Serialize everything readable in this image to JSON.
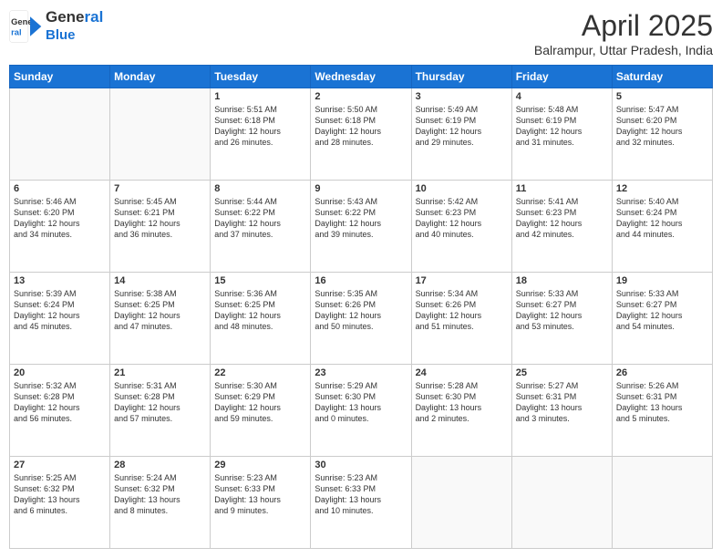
{
  "header": {
    "logo_line1": "General",
    "logo_line2": "Blue",
    "title": "April 2025",
    "subtitle": "Balrampur, Uttar Pradesh, India"
  },
  "weekdays": [
    "Sunday",
    "Monday",
    "Tuesday",
    "Wednesday",
    "Thursday",
    "Friday",
    "Saturday"
  ],
  "weeks": [
    [
      {
        "day": "",
        "info": ""
      },
      {
        "day": "",
        "info": ""
      },
      {
        "day": "1",
        "info": "Sunrise: 5:51 AM\nSunset: 6:18 PM\nDaylight: 12 hours\nand 26 minutes."
      },
      {
        "day": "2",
        "info": "Sunrise: 5:50 AM\nSunset: 6:18 PM\nDaylight: 12 hours\nand 28 minutes."
      },
      {
        "day": "3",
        "info": "Sunrise: 5:49 AM\nSunset: 6:19 PM\nDaylight: 12 hours\nand 29 minutes."
      },
      {
        "day": "4",
        "info": "Sunrise: 5:48 AM\nSunset: 6:19 PM\nDaylight: 12 hours\nand 31 minutes."
      },
      {
        "day": "5",
        "info": "Sunrise: 5:47 AM\nSunset: 6:20 PM\nDaylight: 12 hours\nand 32 minutes."
      }
    ],
    [
      {
        "day": "6",
        "info": "Sunrise: 5:46 AM\nSunset: 6:20 PM\nDaylight: 12 hours\nand 34 minutes."
      },
      {
        "day": "7",
        "info": "Sunrise: 5:45 AM\nSunset: 6:21 PM\nDaylight: 12 hours\nand 36 minutes."
      },
      {
        "day": "8",
        "info": "Sunrise: 5:44 AM\nSunset: 6:22 PM\nDaylight: 12 hours\nand 37 minutes."
      },
      {
        "day": "9",
        "info": "Sunrise: 5:43 AM\nSunset: 6:22 PM\nDaylight: 12 hours\nand 39 minutes."
      },
      {
        "day": "10",
        "info": "Sunrise: 5:42 AM\nSunset: 6:23 PM\nDaylight: 12 hours\nand 40 minutes."
      },
      {
        "day": "11",
        "info": "Sunrise: 5:41 AM\nSunset: 6:23 PM\nDaylight: 12 hours\nand 42 minutes."
      },
      {
        "day": "12",
        "info": "Sunrise: 5:40 AM\nSunset: 6:24 PM\nDaylight: 12 hours\nand 44 minutes."
      }
    ],
    [
      {
        "day": "13",
        "info": "Sunrise: 5:39 AM\nSunset: 6:24 PM\nDaylight: 12 hours\nand 45 minutes."
      },
      {
        "day": "14",
        "info": "Sunrise: 5:38 AM\nSunset: 6:25 PM\nDaylight: 12 hours\nand 47 minutes."
      },
      {
        "day": "15",
        "info": "Sunrise: 5:36 AM\nSunset: 6:25 PM\nDaylight: 12 hours\nand 48 minutes."
      },
      {
        "day": "16",
        "info": "Sunrise: 5:35 AM\nSunset: 6:26 PM\nDaylight: 12 hours\nand 50 minutes."
      },
      {
        "day": "17",
        "info": "Sunrise: 5:34 AM\nSunset: 6:26 PM\nDaylight: 12 hours\nand 51 minutes."
      },
      {
        "day": "18",
        "info": "Sunrise: 5:33 AM\nSunset: 6:27 PM\nDaylight: 12 hours\nand 53 minutes."
      },
      {
        "day": "19",
        "info": "Sunrise: 5:33 AM\nSunset: 6:27 PM\nDaylight: 12 hours\nand 54 minutes."
      }
    ],
    [
      {
        "day": "20",
        "info": "Sunrise: 5:32 AM\nSunset: 6:28 PM\nDaylight: 12 hours\nand 56 minutes."
      },
      {
        "day": "21",
        "info": "Sunrise: 5:31 AM\nSunset: 6:28 PM\nDaylight: 12 hours\nand 57 minutes."
      },
      {
        "day": "22",
        "info": "Sunrise: 5:30 AM\nSunset: 6:29 PM\nDaylight: 12 hours\nand 59 minutes."
      },
      {
        "day": "23",
        "info": "Sunrise: 5:29 AM\nSunset: 6:30 PM\nDaylight: 13 hours\nand 0 minutes."
      },
      {
        "day": "24",
        "info": "Sunrise: 5:28 AM\nSunset: 6:30 PM\nDaylight: 13 hours\nand 2 minutes."
      },
      {
        "day": "25",
        "info": "Sunrise: 5:27 AM\nSunset: 6:31 PM\nDaylight: 13 hours\nand 3 minutes."
      },
      {
        "day": "26",
        "info": "Sunrise: 5:26 AM\nSunset: 6:31 PM\nDaylight: 13 hours\nand 5 minutes."
      }
    ],
    [
      {
        "day": "27",
        "info": "Sunrise: 5:25 AM\nSunset: 6:32 PM\nDaylight: 13 hours\nand 6 minutes."
      },
      {
        "day": "28",
        "info": "Sunrise: 5:24 AM\nSunset: 6:32 PM\nDaylight: 13 hours\nand 8 minutes."
      },
      {
        "day": "29",
        "info": "Sunrise: 5:23 AM\nSunset: 6:33 PM\nDaylight: 13 hours\nand 9 minutes."
      },
      {
        "day": "30",
        "info": "Sunrise: 5:23 AM\nSunset: 6:33 PM\nDaylight: 13 hours\nand 10 minutes."
      },
      {
        "day": "",
        "info": ""
      },
      {
        "day": "",
        "info": ""
      },
      {
        "day": "",
        "info": ""
      }
    ]
  ]
}
